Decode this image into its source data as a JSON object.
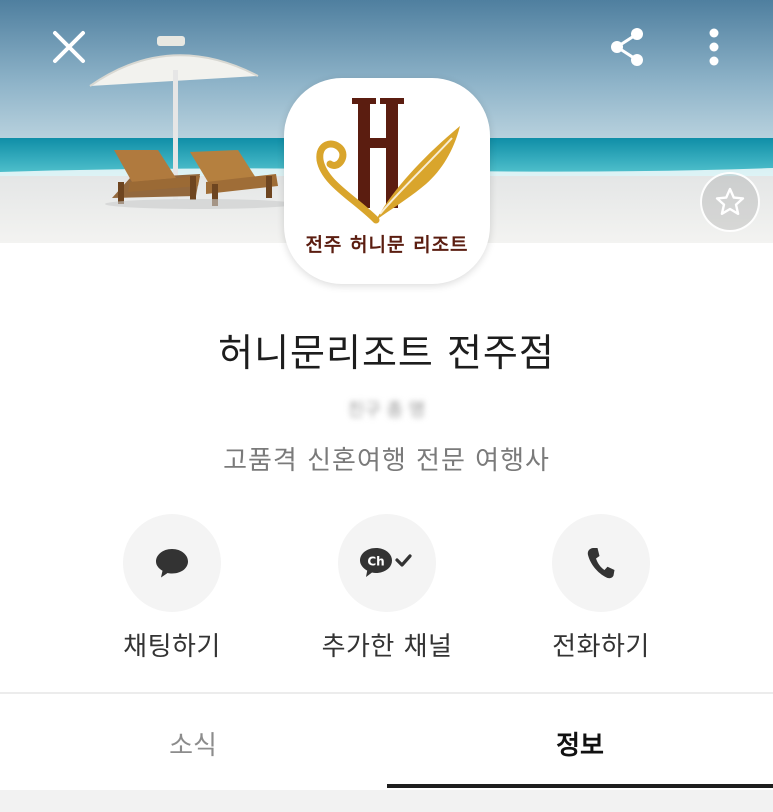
{
  "header": {
    "close_icon": "close-icon",
    "share_icon": "share-icon",
    "more_icon": "more-vertical-icon",
    "favorite_icon": "star-icon"
  },
  "logo": {
    "text": "전주 허니문 리조트",
    "colors": {
      "brown": "#5b1d10",
      "gold": "#d9a52c"
    }
  },
  "profile": {
    "name": "허니문리조트 전주점",
    "friends": "친구 총 명",
    "description": "고품격 신혼여행 전문 여행사"
  },
  "actions": [
    {
      "label": "채팅하기",
      "icon": "chat-bubble-icon"
    },
    {
      "label": "추가한 채널",
      "icon": "channel-check-icon"
    },
    {
      "label": "전화하기",
      "icon": "phone-icon"
    }
  ],
  "tabs": [
    {
      "label": "소식",
      "active": false
    },
    {
      "label": "정보",
      "active": true
    }
  ]
}
